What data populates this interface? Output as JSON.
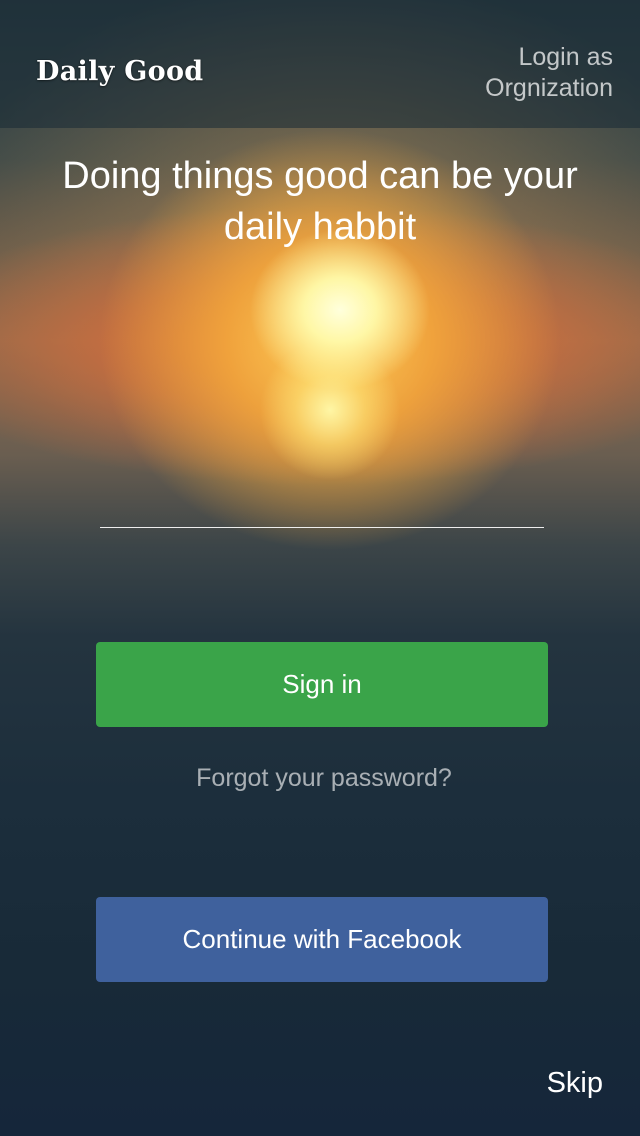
{
  "header": {
    "logo_text": "Daily Good",
    "org_login_line1": "Login as",
    "org_login_line2": "Orgnization"
  },
  "hero": {
    "tagline_line1": "Doing things good can be your",
    "tagline_line2": "daily habbit"
  },
  "form": {
    "input_value": "",
    "sign_in_label": "Sign in",
    "forgot_password_label": "Forgot your password?",
    "facebook_label": "Continue with Facebook"
  },
  "footer": {
    "skip_label": "Skip"
  },
  "colors": {
    "sign_in_button": "#3aa449",
    "facebook_button": "#3f619d",
    "sunset_accent": "#e4763a",
    "background_dark": "#17293a"
  }
}
